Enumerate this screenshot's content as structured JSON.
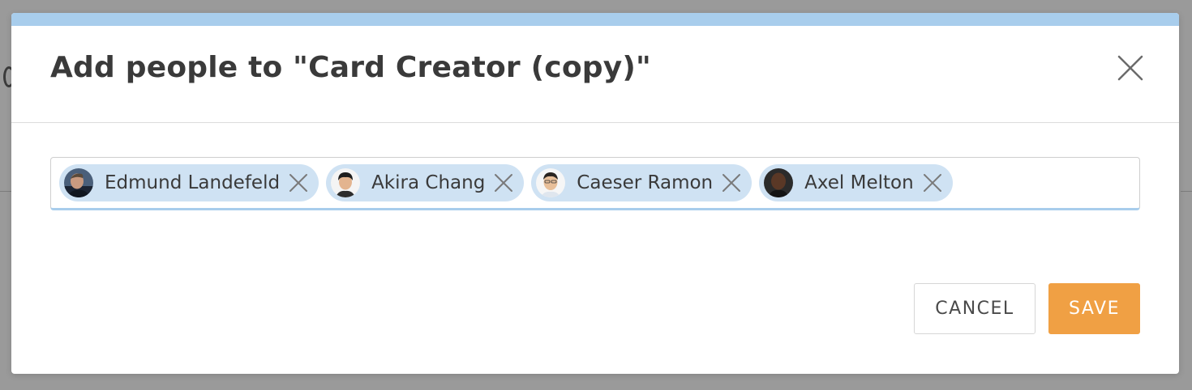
{
  "dialog": {
    "title": "Add people to \"Card Creator (copy)\"",
    "close_icon": "close-icon",
    "accent_color": "#a8cdec"
  },
  "people_field": {
    "value": "",
    "chips": [
      {
        "name": "Edmund Landefeld",
        "avatar_icon": "avatar",
        "remove_icon": "remove-icon"
      },
      {
        "name": "Akira Chang",
        "avatar_icon": "avatar",
        "remove_icon": "remove-icon"
      },
      {
        "name": "Caeser Ramon",
        "avatar_icon": "avatar",
        "remove_icon": "remove-icon"
      },
      {
        "name": "Axel Melton",
        "avatar_icon": "avatar",
        "remove_icon": "remove-icon"
      }
    ],
    "chip_color": "#cfe2f3"
  },
  "actions": {
    "cancel_label": "CANCEL",
    "save_label": "SAVE",
    "save_color": "#f0a044"
  }
}
